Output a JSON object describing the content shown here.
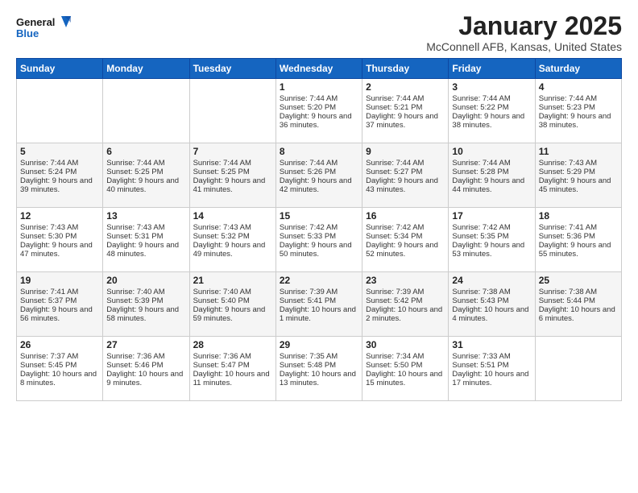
{
  "header": {
    "logo_line1": "General",
    "logo_line2": "Blue",
    "month": "January 2025",
    "location": "McConnell AFB, Kansas, United States"
  },
  "weekdays": [
    "Sunday",
    "Monday",
    "Tuesday",
    "Wednesday",
    "Thursday",
    "Friday",
    "Saturday"
  ],
  "weeks": [
    [
      {
        "day": "",
        "content": ""
      },
      {
        "day": "",
        "content": ""
      },
      {
        "day": "",
        "content": ""
      },
      {
        "day": "1",
        "content": "Sunrise: 7:44 AM\nSunset: 5:20 PM\nDaylight: 9 hours and 36 minutes."
      },
      {
        "day": "2",
        "content": "Sunrise: 7:44 AM\nSunset: 5:21 PM\nDaylight: 9 hours and 37 minutes."
      },
      {
        "day": "3",
        "content": "Sunrise: 7:44 AM\nSunset: 5:22 PM\nDaylight: 9 hours and 38 minutes."
      },
      {
        "day": "4",
        "content": "Sunrise: 7:44 AM\nSunset: 5:23 PM\nDaylight: 9 hours and 38 minutes."
      }
    ],
    [
      {
        "day": "5",
        "content": "Sunrise: 7:44 AM\nSunset: 5:24 PM\nDaylight: 9 hours and 39 minutes."
      },
      {
        "day": "6",
        "content": "Sunrise: 7:44 AM\nSunset: 5:25 PM\nDaylight: 9 hours and 40 minutes."
      },
      {
        "day": "7",
        "content": "Sunrise: 7:44 AM\nSunset: 5:25 PM\nDaylight: 9 hours and 41 minutes."
      },
      {
        "day": "8",
        "content": "Sunrise: 7:44 AM\nSunset: 5:26 PM\nDaylight: 9 hours and 42 minutes."
      },
      {
        "day": "9",
        "content": "Sunrise: 7:44 AM\nSunset: 5:27 PM\nDaylight: 9 hours and 43 minutes."
      },
      {
        "day": "10",
        "content": "Sunrise: 7:44 AM\nSunset: 5:28 PM\nDaylight: 9 hours and 44 minutes."
      },
      {
        "day": "11",
        "content": "Sunrise: 7:43 AM\nSunset: 5:29 PM\nDaylight: 9 hours and 45 minutes."
      }
    ],
    [
      {
        "day": "12",
        "content": "Sunrise: 7:43 AM\nSunset: 5:30 PM\nDaylight: 9 hours and 47 minutes."
      },
      {
        "day": "13",
        "content": "Sunrise: 7:43 AM\nSunset: 5:31 PM\nDaylight: 9 hours and 48 minutes."
      },
      {
        "day": "14",
        "content": "Sunrise: 7:43 AM\nSunset: 5:32 PM\nDaylight: 9 hours and 49 minutes."
      },
      {
        "day": "15",
        "content": "Sunrise: 7:42 AM\nSunset: 5:33 PM\nDaylight: 9 hours and 50 minutes."
      },
      {
        "day": "16",
        "content": "Sunrise: 7:42 AM\nSunset: 5:34 PM\nDaylight: 9 hours and 52 minutes."
      },
      {
        "day": "17",
        "content": "Sunrise: 7:42 AM\nSunset: 5:35 PM\nDaylight: 9 hours and 53 minutes."
      },
      {
        "day": "18",
        "content": "Sunrise: 7:41 AM\nSunset: 5:36 PM\nDaylight: 9 hours and 55 minutes."
      }
    ],
    [
      {
        "day": "19",
        "content": "Sunrise: 7:41 AM\nSunset: 5:37 PM\nDaylight: 9 hours and 56 minutes."
      },
      {
        "day": "20",
        "content": "Sunrise: 7:40 AM\nSunset: 5:39 PM\nDaylight: 9 hours and 58 minutes."
      },
      {
        "day": "21",
        "content": "Sunrise: 7:40 AM\nSunset: 5:40 PM\nDaylight: 9 hours and 59 minutes."
      },
      {
        "day": "22",
        "content": "Sunrise: 7:39 AM\nSunset: 5:41 PM\nDaylight: 10 hours and 1 minute."
      },
      {
        "day": "23",
        "content": "Sunrise: 7:39 AM\nSunset: 5:42 PM\nDaylight: 10 hours and 2 minutes."
      },
      {
        "day": "24",
        "content": "Sunrise: 7:38 AM\nSunset: 5:43 PM\nDaylight: 10 hours and 4 minutes."
      },
      {
        "day": "25",
        "content": "Sunrise: 7:38 AM\nSunset: 5:44 PM\nDaylight: 10 hours and 6 minutes."
      }
    ],
    [
      {
        "day": "26",
        "content": "Sunrise: 7:37 AM\nSunset: 5:45 PM\nDaylight: 10 hours and 8 minutes."
      },
      {
        "day": "27",
        "content": "Sunrise: 7:36 AM\nSunset: 5:46 PM\nDaylight: 10 hours and 9 minutes."
      },
      {
        "day": "28",
        "content": "Sunrise: 7:36 AM\nSunset: 5:47 PM\nDaylight: 10 hours and 11 minutes."
      },
      {
        "day": "29",
        "content": "Sunrise: 7:35 AM\nSunset: 5:48 PM\nDaylight: 10 hours and 13 minutes."
      },
      {
        "day": "30",
        "content": "Sunrise: 7:34 AM\nSunset: 5:50 PM\nDaylight: 10 hours and 15 minutes."
      },
      {
        "day": "31",
        "content": "Sunrise: 7:33 AM\nSunset: 5:51 PM\nDaylight: 10 hours and 17 minutes."
      },
      {
        "day": "",
        "content": ""
      }
    ]
  ]
}
